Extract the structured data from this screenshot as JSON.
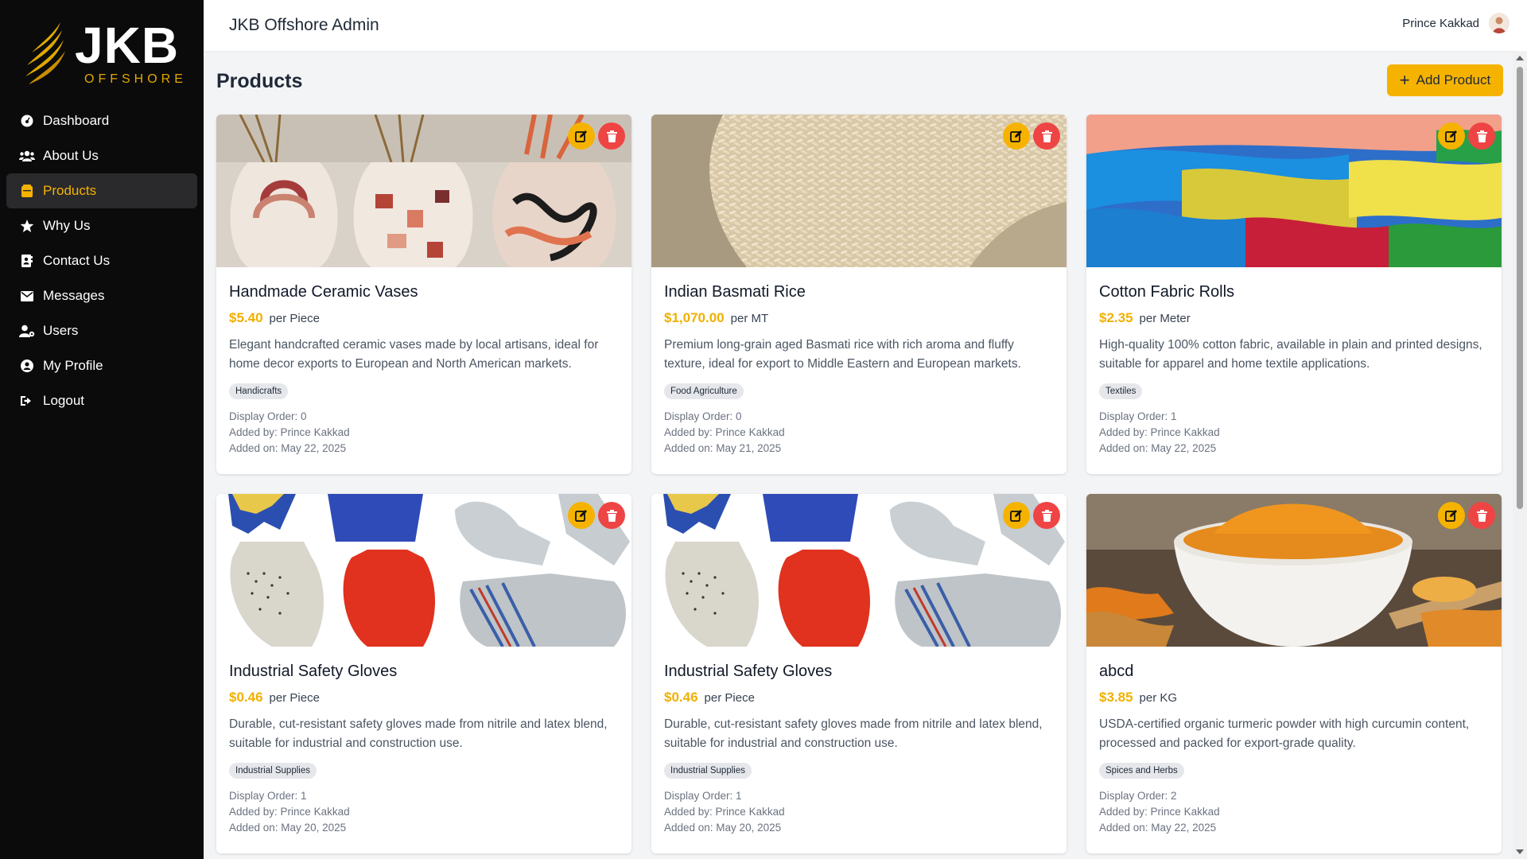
{
  "brand": {
    "name": "JKB",
    "sub": "OFFSHORE"
  },
  "header": {
    "title": "JKB Offshore Admin",
    "user_name": "Prince Kakkad"
  },
  "sidebar": {
    "items": [
      {
        "label": "Dashboard",
        "icon": "dashboard-icon",
        "active": false
      },
      {
        "label": "About Us",
        "icon": "users-icon",
        "active": false
      },
      {
        "label": "Products",
        "icon": "box-icon",
        "active": true
      },
      {
        "label": "Why Us",
        "icon": "star-icon",
        "active": false
      },
      {
        "label": "Contact Us",
        "icon": "address-book-icon",
        "active": false
      },
      {
        "label": "Messages",
        "icon": "envelope-icon",
        "active": false
      },
      {
        "label": "Users",
        "icon": "user-gear-icon",
        "active": false
      },
      {
        "label": "My Profile",
        "icon": "user-circle-icon",
        "active": false
      },
      {
        "label": "Logout",
        "icon": "logout-icon",
        "active": false
      }
    ]
  },
  "main": {
    "page_title": "Products",
    "add_button": "Add Product",
    "products": [
      {
        "name": "Handmade Ceramic Vases",
        "price": "$5.40",
        "unit": "per Piece",
        "description": "Elegant handcrafted ceramic vases made by local artisans, ideal for home decor exports to European and North American markets.",
        "category": "Handicrafts",
        "display_order": "Display Order: 0",
        "added_by": "Added by: Prince Kakkad",
        "added_on": "Added on: May 22, 2025"
      },
      {
        "name": "Indian Basmati Rice",
        "price": "$1,070.00",
        "unit": "per MT",
        "description": "Premium long-grain aged Basmati rice with rich aroma and fluffy texture, ideal for export to Middle Eastern and European markets.",
        "category": "Food Agriculture",
        "display_order": "Display Order: 0",
        "added_by": "Added by: Prince Kakkad",
        "added_on": "Added on: May 21, 2025"
      },
      {
        "name": "Cotton Fabric Rolls",
        "price": "$2.35",
        "unit": "per Meter",
        "description": "High-quality 100% cotton fabric, available in plain and printed designs, suitable for apparel and home textile applications.",
        "category": "Textiles",
        "display_order": "Display Order: 1",
        "added_by": "Added by: Prince Kakkad",
        "added_on": "Added on: May 22, 2025"
      },
      {
        "name": "Industrial Safety Gloves",
        "price": "$0.46",
        "unit": "per Piece",
        "description": "Durable, cut-resistant safety gloves made from nitrile and latex blend, suitable for industrial and construction use.",
        "category": "Industrial Supplies",
        "display_order": "Display Order: 1",
        "added_by": "Added by: Prince Kakkad",
        "added_on": "Added on: May 20, 2025"
      },
      {
        "name": "Industrial Safety Gloves",
        "price": "$0.46",
        "unit": "per Piece",
        "description": "Durable, cut-resistant safety gloves made from nitrile and latex blend, suitable for industrial and construction use.",
        "category": "Industrial Supplies",
        "display_order": "Display Order: 1",
        "added_by": "Added by: Prince Kakkad",
        "added_on": "Added on: May 20, 2025"
      },
      {
        "name": "abcd",
        "price": "$3.85",
        "unit": "per KG",
        "description": "USDA-certified organic turmeric powder with high curcumin content, processed and packed for export-grade quality.",
        "category": "Spices and Herbs",
        "display_order": "Display Order: 2",
        "added_by": "Added by: Prince Kakkad",
        "added_on": "Added on: May 22, 2025"
      }
    ]
  },
  "colors": {
    "accent": "#f5b300",
    "danger": "#ef4444",
    "sidebar_bg": "#0b0b0c"
  }
}
